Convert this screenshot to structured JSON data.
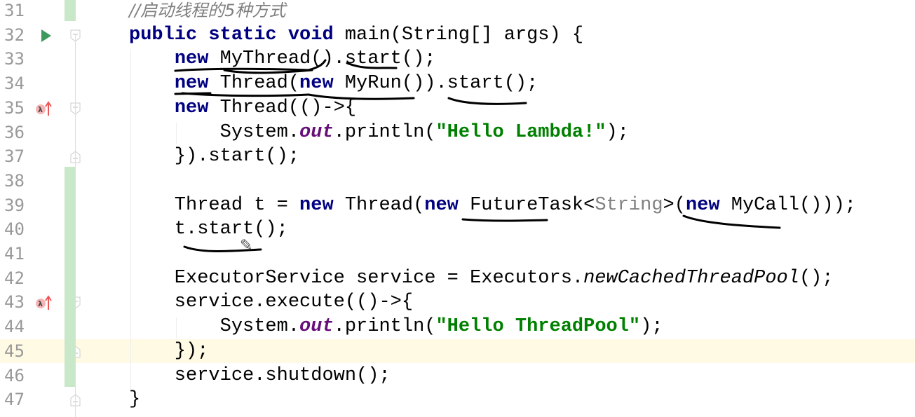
{
  "editor": {
    "current_line": 45,
    "lines": [
      {
        "n": "31",
        "t": [
          [
            "//启动线程的5种方式",
            "cm"
          ]
        ]
      },
      {
        "n": "32",
        "t": [
          [
            "public static void",
            "kw"
          ],
          [
            " main(String[] args) {",
            ""
          ]
        ]
      },
      {
        "n": "33",
        "t": [
          [
            "    ",
            ""
          ],
          [
            "new",
            "kw"
          ],
          [
            " MyThread().start();",
            ""
          ]
        ]
      },
      {
        "n": "34",
        "t": [
          [
            "    ",
            ""
          ],
          [
            "new",
            "kw"
          ],
          [
            " Thread(",
            ""
          ],
          [
            "new",
            "kw"
          ],
          [
            " MyRun()).start();",
            ""
          ]
        ]
      },
      {
        "n": "35",
        "t": [
          [
            "    ",
            ""
          ],
          [
            "new",
            "kw"
          ],
          [
            " Thread(()->{",
            ""
          ]
        ]
      },
      {
        "n": "36",
        "t": [
          [
            "        System.",
            ""
          ],
          [
            "out",
            "field"
          ],
          [
            ".println(",
            ""
          ],
          [
            "\"Hello Lambda!\"",
            "str"
          ],
          [
            ");",
            ""
          ]
        ]
      },
      {
        "n": "37",
        "t": [
          [
            "    }).start();",
            ""
          ]
        ]
      },
      {
        "n": "38",
        "t": []
      },
      {
        "n": "39",
        "t": [
          [
            "    Thread t = ",
            ""
          ],
          [
            "new",
            "kw"
          ],
          [
            " Thread(",
            ""
          ],
          [
            "new",
            "kw"
          ],
          [
            " FutureTask<",
            ""
          ],
          [
            "String",
            "gen"
          ],
          [
            ">(",
            ""
          ],
          [
            "new",
            "kw"
          ],
          [
            " MyCall()));",
            ""
          ]
        ]
      },
      {
        "n": "40",
        "t": [
          [
            "    t.start();",
            ""
          ]
        ]
      },
      {
        "n": "41",
        "t": []
      },
      {
        "n": "42",
        "t": [
          [
            "    ExecutorService service = Executors.",
            ""
          ],
          [
            "newCachedThreadPool",
            "it"
          ],
          [
            "();",
            ""
          ]
        ]
      },
      {
        "n": "43",
        "t": [
          [
            "    service.execute(()->{",
            ""
          ]
        ]
      },
      {
        "n": "44",
        "t": [
          [
            "        System.",
            ""
          ],
          [
            "out",
            "field"
          ],
          [
            ".println(",
            ""
          ],
          [
            "\"Hello ThreadPool\"",
            "str"
          ],
          [
            ");",
            ""
          ]
        ]
      },
      {
        "n": "45",
        "t": [
          [
            "    });",
            ""
          ]
        ]
      },
      {
        "n": "46",
        "t": [
          [
            "    service.shutdown();",
            ""
          ]
        ]
      },
      {
        "n": "47",
        "t": [
          [
            "}",
            ""
          ]
        ]
      }
    ],
    "gutter_icons": {
      "32": "run-icon",
      "35": "lambda-override-icon",
      "43": "lambda-override-icon"
    },
    "fold_markers": {
      "32": "open",
      "35": "open",
      "37": "close",
      "43": "open",
      "45": "close",
      "47": "close"
    },
    "colors": {
      "keyword": "#000080",
      "string": "#008000",
      "field": "#660e7a",
      "comment": "#808080",
      "change_bar": "#c9e7c9",
      "current_line": "#fffae3"
    }
  }
}
